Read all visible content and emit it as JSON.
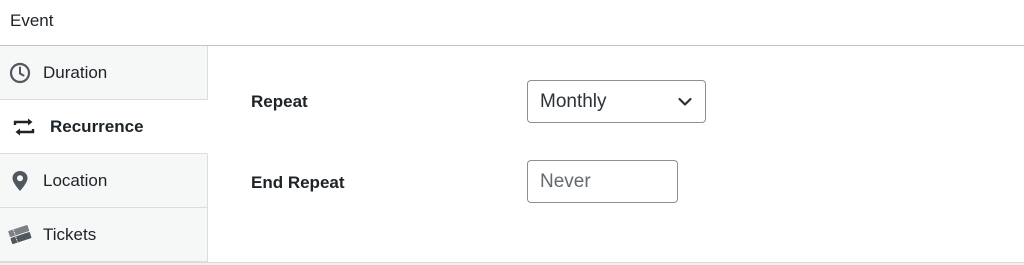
{
  "panel": {
    "title": "Event"
  },
  "tabs": [
    {
      "id": "duration",
      "label": "Duration",
      "icon": "clock-icon",
      "active": false
    },
    {
      "id": "recurrence",
      "label": "Recurrence",
      "icon": "repeat-icon",
      "active": true
    },
    {
      "id": "location",
      "label": "Location",
      "icon": "map-pin-icon",
      "active": false
    },
    {
      "id": "tickets",
      "label": "Tickets",
      "icon": "tickets-icon",
      "active": false
    }
  ],
  "recurrence": {
    "repeat_label": "Repeat",
    "repeat_value": "Monthly",
    "end_repeat_label": "End Repeat",
    "end_repeat_placeholder": "Never"
  },
  "colors": {
    "text": "#1d2327",
    "border": "#8c8f94",
    "tab_inactive_bg": "#f6f7f7",
    "icon": "#50575e"
  }
}
